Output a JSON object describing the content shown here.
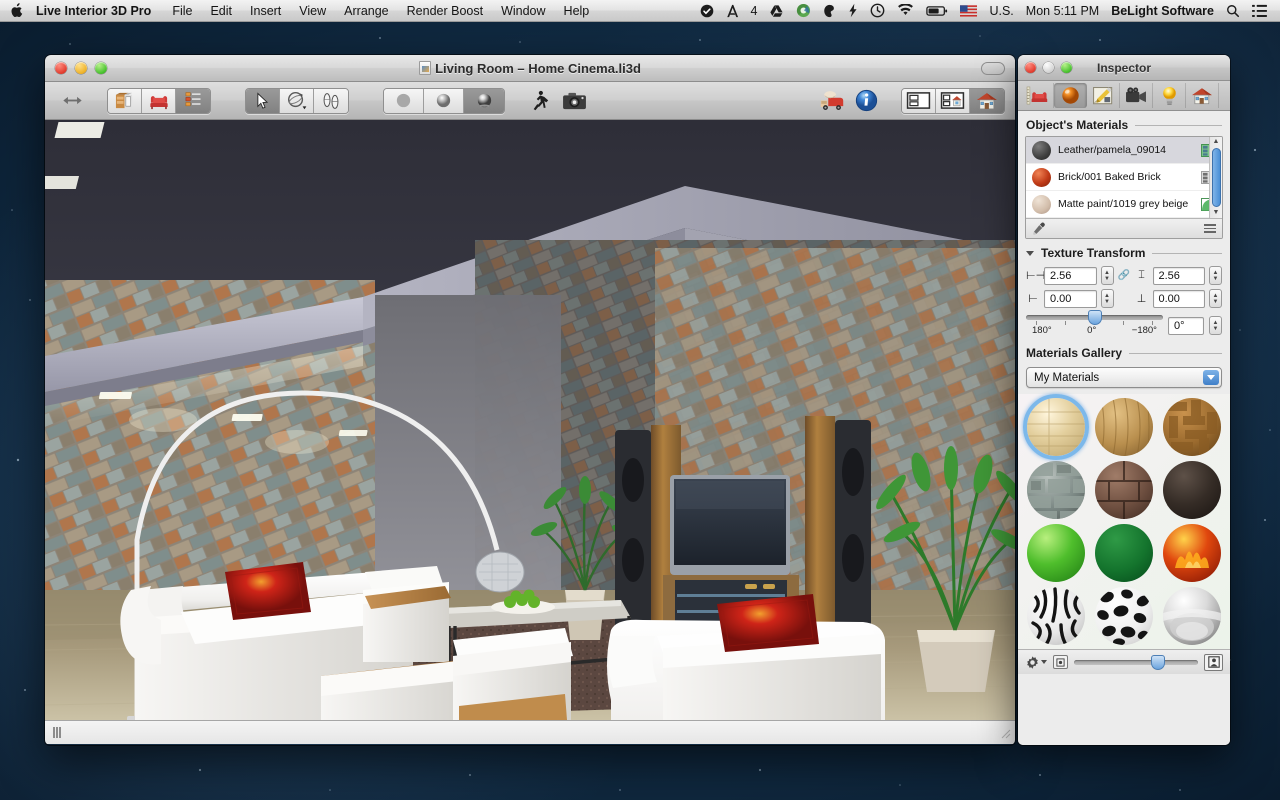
{
  "menubar": {
    "apple_icon": "apple-logo-icon",
    "app_name": "Live Interior 3D Pro",
    "menus": [
      "File",
      "Edit",
      "Insert",
      "View",
      "Arrange",
      "Render Boost",
      "Window",
      "Help"
    ],
    "status_items": [
      {
        "name": "shield-icon",
        "glyph": "✔"
      },
      {
        "name": "adobe-icon",
        "glyph": "A"
      },
      {
        "name": "notification-count",
        "glyph": "4"
      },
      {
        "name": "google-drive-icon",
        "glyph": "▲"
      },
      {
        "name": "dropbox-sync-icon",
        "glyph": "✿"
      },
      {
        "name": "evernote-icon",
        "glyph": "◑"
      },
      {
        "name": "flash-icon",
        "glyph": "⚡"
      },
      {
        "name": "time-machine-icon",
        "glyph": "◴"
      },
      {
        "name": "wifi-icon",
        "glyph": "◠"
      },
      {
        "name": "battery-icon",
        "glyph": "▭"
      },
      {
        "name": "flag-icon",
        "glyph": "⚑"
      }
    ],
    "input_source": "U.S.",
    "clock": "Mon 5:11 PM",
    "user_name": "BeLight Software",
    "search_icon": "search-icon",
    "notification_center_icon": "notification-center-icon"
  },
  "window": {
    "title": "Living Room – Home Cinema.li3d",
    "close_label": "Close",
    "minimize_label": "Minimize",
    "zoom_label": "Zoom",
    "toolbar_toggle_label": "Toggle Toolbar"
  },
  "toolbar": {
    "groups": [
      {
        "name": "view-mode",
        "buttons": [
          {
            "name": "toolbar-button-floor-plan",
            "icon": "floor-plan-icon",
            "active": false
          },
          {
            "name": "toolbar-button-furniture",
            "icon": "armchair-icon",
            "active": false
          },
          {
            "name": "toolbar-button-object-list",
            "icon": "object-list-icon",
            "active": true
          }
        ]
      },
      {
        "name": "edit-tools",
        "buttons": [
          {
            "name": "toolbar-button-select",
            "icon": "arrow-cursor-icon",
            "active": true
          },
          {
            "name": "toolbar-button-orbit",
            "icon": "orbit-rotate-icon",
            "active": false
          },
          {
            "name": "toolbar-button-walk",
            "icon": "footprints-icon",
            "active": false
          }
        ]
      },
      {
        "name": "render-quality",
        "buttons": [
          {
            "name": "toolbar-button-flat-shading",
            "icon": "flat-sphere-icon",
            "active": false
          },
          {
            "name": "toolbar-button-smooth-shading",
            "icon": "shaded-sphere-icon",
            "active": false
          },
          {
            "name": "toolbar-button-realistic-shading",
            "icon": "glossy-sphere-icon",
            "active": true
          }
        ]
      }
    ],
    "standalone": [
      {
        "name": "toolbar-button-walkthrough",
        "icon": "walking-person-icon"
      },
      {
        "name": "toolbar-button-camera",
        "icon": "camera-icon"
      }
    ],
    "right_items": [
      {
        "name": "toolbar-button-render-boost",
        "icon": "render-truck-icon"
      },
      {
        "name": "toolbar-button-inspector",
        "icon": "info-circle-icon"
      }
    ],
    "layout_group": [
      {
        "name": "toolbar-button-layout-2d",
        "icon": "layout-split-icon",
        "active": false
      },
      {
        "name": "toolbar-button-layout-split",
        "icon": "layout-plan-3d-icon",
        "active": false
      },
      {
        "name": "toolbar-button-layout-3d",
        "icon": "house-3d-icon",
        "active": true
      }
    ]
  },
  "viewport": {
    "name": "3d-render-viewport",
    "description": "Rendered living room with home cinema"
  },
  "statusbar": {
    "grip_label": "Resize split",
    "resize_label": "Resize window"
  },
  "inspector": {
    "title": "Inspector",
    "tabs": [
      {
        "name": "inspector-tab-object",
        "icon": "object-ruler-icon",
        "active": false
      },
      {
        "name": "inspector-tab-materials",
        "icon": "material-sphere-icon",
        "active": true
      },
      {
        "name": "inspector-tab-edit",
        "icon": "pencil-edit-icon",
        "active": false
      },
      {
        "name": "inspector-tab-camera",
        "icon": "video-camera-icon",
        "active": false
      },
      {
        "name": "inspector-tab-light",
        "icon": "light-bulb-icon",
        "active": false
      },
      {
        "name": "inspector-tab-building",
        "icon": "house-icon",
        "active": false
      }
    ],
    "object_materials": {
      "section_title": "Object's Materials",
      "items": [
        {
          "name": "Leather/pamela_09014",
          "color": "#4a4a4a",
          "selected": true,
          "badge": "texture-tile-green-icon"
        },
        {
          "name": "Brick/001 Baked Brick",
          "color": "#b8391c",
          "selected": false,
          "badge": "texture-tile-grey-icon"
        },
        {
          "name": "Matte paint/1019 grey beige",
          "color": "#d7c3b3",
          "selected": false,
          "badge": "gradient-green-icon"
        }
      ],
      "eyedropper_icon": "eyedropper-icon",
      "menu_icon": "list-menu-icon"
    },
    "texture_transform": {
      "section_title": "Texture Transform",
      "expanded": true,
      "width_label": "width-icon",
      "width_value": "2.56",
      "link_icon": "link-chain-icon",
      "height_label": "height-icon",
      "height_value": "2.56",
      "offset_x_label": "offset-x-icon",
      "offset_x_value": "0.00",
      "offset_y_label": "offset-y-icon",
      "offset_y_value": "0.00",
      "rotation_value": "0°",
      "slider_min_label": "180°",
      "slider_mid_label": "0°",
      "slider_max_label": "−180°",
      "slider_position_percent": 50
    },
    "materials_gallery": {
      "section_title": "Materials Gallery",
      "selected_collection": "My Materials",
      "swatches": [
        {
          "name": "swatch-light-wood-planks",
          "selected": true
        },
        {
          "name": "swatch-oak-wood-grain",
          "selected": false
        },
        {
          "name": "swatch-basket-weave-wood",
          "selected": false
        },
        {
          "name": "swatch-stone-brick",
          "selected": false
        },
        {
          "name": "swatch-dark-brick",
          "selected": false
        },
        {
          "name": "swatch-black-leather",
          "selected": false
        },
        {
          "name": "swatch-bright-green",
          "selected": false
        },
        {
          "name": "swatch-dark-green",
          "selected": false
        },
        {
          "name": "swatch-fire-flame",
          "selected": false
        },
        {
          "name": "swatch-zebra-print",
          "selected": false
        },
        {
          "name": "swatch-cow-print",
          "selected": false
        },
        {
          "name": "swatch-chrome-metal",
          "selected": false
        }
      ],
      "footer": {
        "gear_icon": "gear-settings-icon",
        "small_icon": "small-thumbnails-icon",
        "large_icon": "large-thumbnails-icon",
        "size_slider_percent": 68
      }
    }
  },
  "colors": {
    "accent_blue": "#4a8fd6",
    "selection_ring": "#7cb8ea",
    "menubar_text": "#141414",
    "desktop": "#13304a"
  }
}
